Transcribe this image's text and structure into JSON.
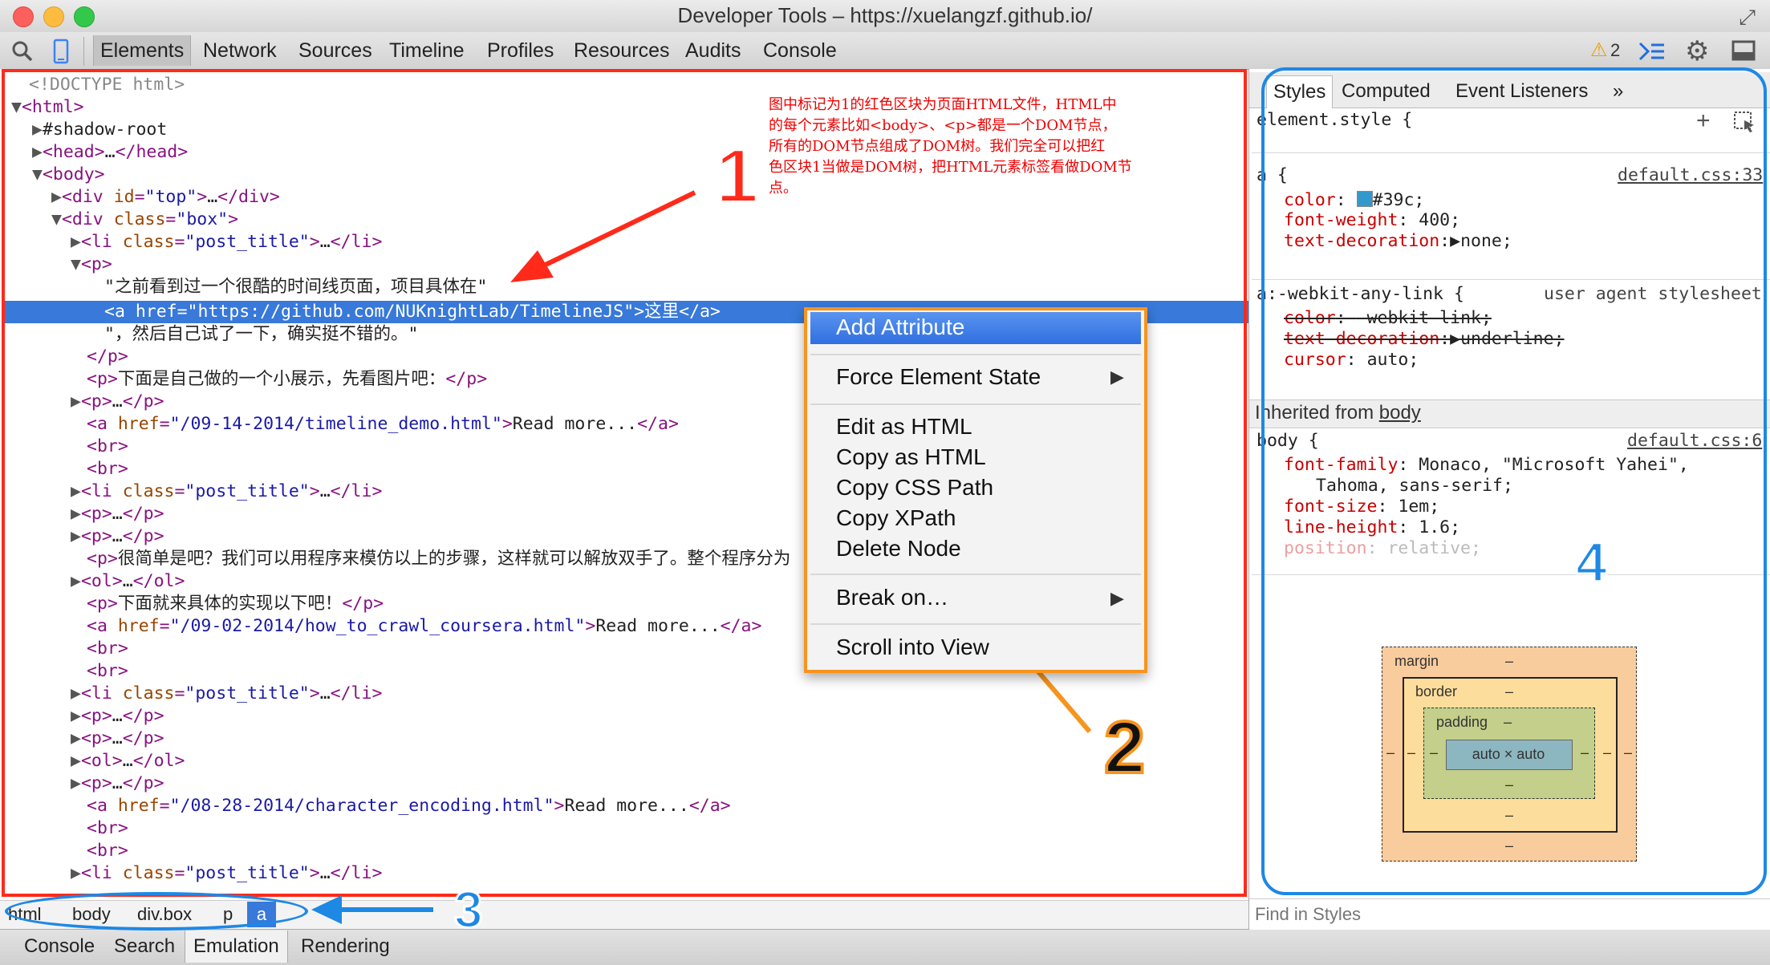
{
  "window": {
    "title": "Developer Tools – https://xuelangzf.github.io/"
  },
  "toolbar": {
    "tabs": [
      "Elements",
      "Network",
      "Sources",
      "Timeline",
      "Profiles",
      "Resources",
      "Audits",
      "Console"
    ],
    "warning_count": "2"
  },
  "elements_tree": {
    "doctype": "<!DOCTYPE html>",
    "selected_text_1": "\"之前看到过一个很酷的时间线页面，项目具体在\"",
    "selected_link_href": "https://github.com/NUKnightLab/TimelineJS",
    "selected_link_text": "这里",
    "selected_text_2": "\"，然后自己试了一下，确实挺不错的。\"",
    "p_intro": "下面是自己做的一个小展示，先看图片吧：",
    "link1_href": "/09-14-2014/timeline_demo.html",
    "link2_href": "/09-02-2014/how_to_crawl_coursera.html",
    "link3_href": "/08-28-2014/character_encoding.html",
    "read_more": "Read more...",
    "p_simple": "很简单是吧？我们可以用程序来模仿以上的步骤，这样就可以解放双手了。整个程序分为",
    "p_impl": "下面就来具体的实现以下吧！"
  },
  "breadcrumb": [
    "html",
    "body",
    "div.box",
    "p",
    "a"
  ],
  "drawer_tabs": [
    "Console",
    "Search",
    "Emulation",
    "Rendering"
  ],
  "styles_panel": {
    "tabs": [
      "Styles",
      "Computed",
      "Event Listeners"
    ],
    "more": "»",
    "element_style": "element.style {",
    "rule_a_selector": "a {",
    "rule_a_source": "default.css:33",
    "rule_a_color_value": "#39c",
    "rule_a_color_swatch": "#3399cc",
    "rule_a_font_weight": "400",
    "rule_a_text_decoration": "none",
    "rule_webkit_selector": "a:-webkit-any-link {",
    "rule_webkit_source": "user agent stylesheet",
    "rule_webkit_color": "-webkit-link",
    "rule_webkit_text_decoration": "underline",
    "rule_webkit_cursor": "auto",
    "inherited_label": "Inherited from",
    "inherited_from": "body",
    "rule_body_selector": "body {",
    "rule_body_source": "default.css:6",
    "font_family": "Monaco, \"Microsoft Yahei\",",
    "font_family_2": "Tahoma, sans-serif;",
    "font_size": "1em",
    "line_height": "1.6",
    "position": "relative",
    "find_placeholder": "Find in Styles"
  },
  "box_model": {
    "margin_label": "margin",
    "border_label": "border",
    "padding_label": "padding",
    "content": "auto × auto",
    "dash": "–"
  },
  "context_menu": {
    "items": [
      "Add Attribute",
      "Force Element State",
      "Edit as HTML",
      "Copy as HTML",
      "Copy CSS Path",
      "Copy XPath",
      "Delete Node",
      "Break on…",
      "Scroll into View"
    ]
  },
  "annotations": {
    "n1": "1",
    "n2": "2",
    "n3": "3",
    "n4": "4",
    "note_1": "图中标记为1的红色区块为页面HTML文件，HTML中",
    "note_2": "的每个元素比如<body>、<p>都是一个DOM节点，",
    "note_3": "所有的DOM节点组成了DOM树。我们完全可以把红",
    "note_4": "色区块1当做是DOM树，把HTML元素标签看做DOM节",
    "note_5": "点。"
  },
  "colors": {
    "red_box": "#ff2a1a",
    "blue_box": "#1e88e5",
    "orange": "#f7941d",
    "selection": "#3879d9"
  }
}
